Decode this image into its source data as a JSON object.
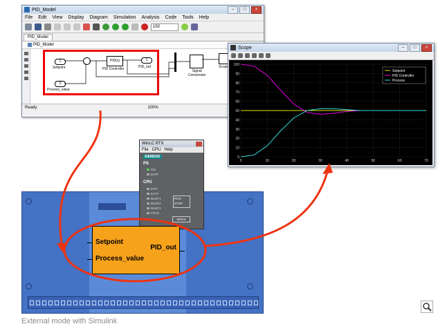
{
  "simulink": {
    "title": "PID_Model",
    "menu": [
      "File",
      "Edit",
      "View",
      "Display",
      "Diagram",
      "Simulation",
      "Analysis",
      "Code",
      "Tools",
      "Help"
    ],
    "stop_time": "150",
    "tab": "PID_Model",
    "breadcrumb": "PID_Model",
    "status_left": "Ready",
    "zoom": "100%",
    "blocks": {
      "setpoint_num": "1",
      "setpoint": "Setpoint",
      "process_num": "2",
      "process": "Process_value",
      "pid_text": "PID(s)",
      "pid": "PID Controller",
      "out_num": "1",
      "out": "PID_out",
      "signal": "Signal\nConversion",
      "scope": "Scope"
    }
  },
  "scope": {
    "title": "Scope",
    "legend": [
      "Setpoint",
      "PID Controller",
      "Process"
    ],
    "colors": {
      "setpoint": "#e6e600",
      "pid": "#e600e6",
      "process": "#33dddd",
      "bg": "#000000",
      "grid": "#555555"
    }
  },
  "chart_data": {
    "type": "line",
    "x": [
      0,
      5,
      10,
      15,
      20,
      25,
      30,
      35,
      40,
      45,
      50,
      55,
      60,
      65,
      70
    ],
    "xlim": [
      0,
      70
    ],
    "ylim": [
      0,
      100
    ],
    "xticks": [
      "0",
      "10",
      "20",
      "30",
      "40",
      "50",
      "60",
      "70"
    ],
    "yticks": [
      "0",
      "10",
      "20",
      "30",
      "40",
      "50",
      "60",
      "70",
      "80",
      "90",
      "100"
    ],
    "series": [
      {
        "name": "Setpoint",
        "values": [
          50,
          50,
          50,
          50,
          50,
          50,
          50,
          50,
          50,
          50,
          50,
          50,
          50,
          50,
          50
        ]
      },
      {
        "name": "PID Controller",
        "values": [
          100,
          98,
          88,
          72,
          57,
          48,
          46,
          47,
          49,
          50,
          50,
          50,
          50,
          50,
          50
        ]
      },
      {
        "name": "Process",
        "values": [
          0,
          2,
          12,
          28,
          42,
          50,
          52,
          52,
          51,
          50,
          50,
          50,
          50,
          50,
          50
        ]
      }
    ]
  },
  "winlc": {
    "title": "WinLC RTX",
    "menu": [
      "File",
      "CPU",
      "Help"
    ],
    "brand": "SIEMENS",
    "ps": "PS",
    "ps_leds": [
      "ON",
      "BATF"
    ],
    "cpu": "CPU",
    "cpu_leds": [
      "INTF",
      "EXTF",
      "BUSF1",
      "BUSF2",
      "BUSF3",
      "FRCE"
    ],
    "run": "RUN",
    "stop": "STOP",
    "mres": "MRES"
  },
  "plc": {
    "in1": "Setpoint",
    "in2": "Process_value",
    "out": "PID_out"
  },
  "caption": "External mode with Simulink"
}
